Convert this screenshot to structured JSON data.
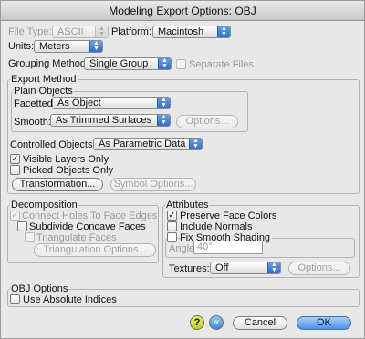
{
  "window": {
    "title": "Modeling Export Options: OBJ"
  },
  "file_type": {
    "label": "File Type:",
    "value": "ASCII"
  },
  "platform": {
    "label": "Platform:",
    "value": "Macintosh"
  },
  "units": {
    "label": "Units:",
    "value": "Meters"
  },
  "grouping": {
    "label": "Grouping Method:",
    "value": "Single Group",
    "separate_files": "Separate Files",
    "separate_files_checked": false
  },
  "export_method": {
    "title": "Export Method",
    "plain_objects": {
      "title": "Plain Objects",
      "facetted_label": "Facetted:",
      "facetted_value": "As Object",
      "smooth_label": "Smooth:",
      "smooth_value": "As Trimmed Surfaces",
      "options_button": "Options..."
    },
    "controlled_label": "Controlled Objects:",
    "controlled_value": "As Parametric Data",
    "visible_layers": "Visible Layers Only",
    "visible_layers_checked": true,
    "picked_objects": "Picked Objects Only",
    "picked_objects_checked": false,
    "transformation_button": "Transformation...",
    "symbol_options_button": "Symbol Options..."
  },
  "decomposition": {
    "title": "Decomposition",
    "connect_holes": "Connect Holes To Face Edges",
    "connect_holes_checked": true,
    "subdivide_concave": "Subdivide Concave Faces",
    "subdivide_concave_checked": false,
    "triangulate": "Triangulate Faces",
    "triangulate_checked": false,
    "triangulation_button": "Triangulation Options..."
  },
  "attributes": {
    "title": "Attributes",
    "preserve_colors": "Preserve Face Colors",
    "preserve_colors_checked": true,
    "include_normals": "Include Normals",
    "include_normals_checked": false,
    "fix_smooth": "Fix Smooth Shading",
    "fix_smooth_checked": false,
    "angle_label": "Angle",
    "angle_value": "40°",
    "textures_label": "Textures:",
    "textures_value": "Off",
    "options_button": "Options..."
  },
  "obj_options": {
    "title": "OBJ Options",
    "absolute_indices": "Use Absolute Indices",
    "absolute_indices_checked": false
  },
  "footer": {
    "help_icon_glyph": "?",
    "revert_icon_glyph": "«",
    "cancel_button": "Cancel",
    "ok_button": "OK"
  },
  "colors": {
    "accent": "#4b92ea",
    "popup_arrow": "#2f6ad0"
  }
}
